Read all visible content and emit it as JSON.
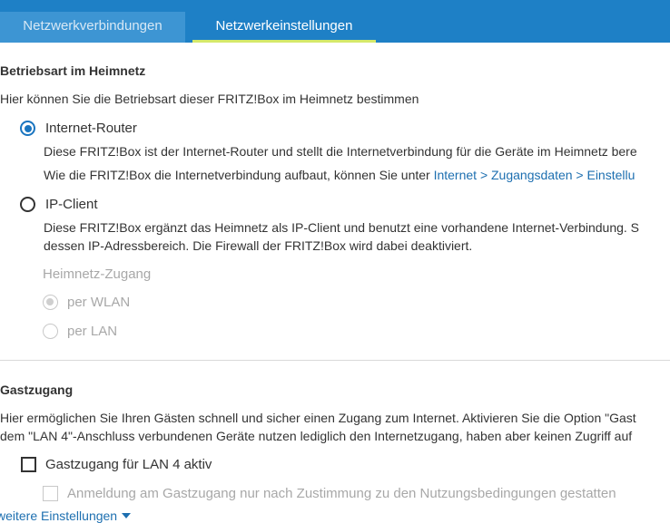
{
  "tabs": [
    {
      "label": "Netzwerkverbindungen",
      "active": false
    },
    {
      "label": "Netzwerkeinstellungen",
      "active": true
    }
  ],
  "mode_section": {
    "heading": "Betriebsart im Heimnetz",
    "intro": "Hier können Sie die Betriebsart dieser FRITZ!Box im Heimnetz bestimmen",
    "router": {
      "label": "Internet-Router",
      "checked": true,
      "desc1": "Diese FRITZ!Box ist der Internet-Router und stellt die Internetverbindung für die Geräte im Heimnetz bere",
      "desc2_prefix": "Wie die FRITZ!Box die Internetverbindung aufbaut, können Sie unter ",
      "desc2_link": "Internet > Zugangsdaten > Einstellu"
    },
    "ip_client": {
      "label": "IP-Client",
      "checked": false,
      "desc1": "Diese FRITZ!Box ergänzt das Heimnetz als IP-Client und benutzt eine vorhandene Internet-Verbindung. S",
      "desc2": "dessen IP-Adressbereich. Die Firewall der FRITZ!Box wird dabei deaktiviert."
    },
    "heimnetz_access": {
      "label": "Heimnetz-Zugang",
      "options": [
        {
          "label": "per WLAN",
          "checked": true,
          "disabled": true
        },
        {
          "label": "per LAN",
          "checked": false,
          "disabled": true
        }
      ]
    }
  },
  "guest_section": {
    "heading": "Gastzugang",
    "desc1": "Hier ermöglichen Sie Ihren Gästen schnell und sicher einen Zugang zum Internet. Aktivieren Sie die Option \"Gast",
    "desc2": "dem \"LAN 4\"-Anschluss verbundenen Geräte nutzen lediglich den Internetzugang, haben aber keinen Zugriff auf",
    "lan4_checkbox": {
      "label": "Gastzugang für LAN 4 aktiv",
      "checked": false
    },
    "consent_checkbox": {
      "label": "Anmeldung am Gastzugang nur nach Zustimmung zu den Nutzungsbedingungen gestatten",
      "checked": false,
      "disabled": true
    },
    "more_settings_link": "weitere Einstellungen"
  },
  "colors": {
    "tab_bar": "#1e80c6",
    "active_tab_underline": "#d5e96a",
    "radio_accent": "#1a75c0",
    "link": "#1d6fb0"
  }
}
